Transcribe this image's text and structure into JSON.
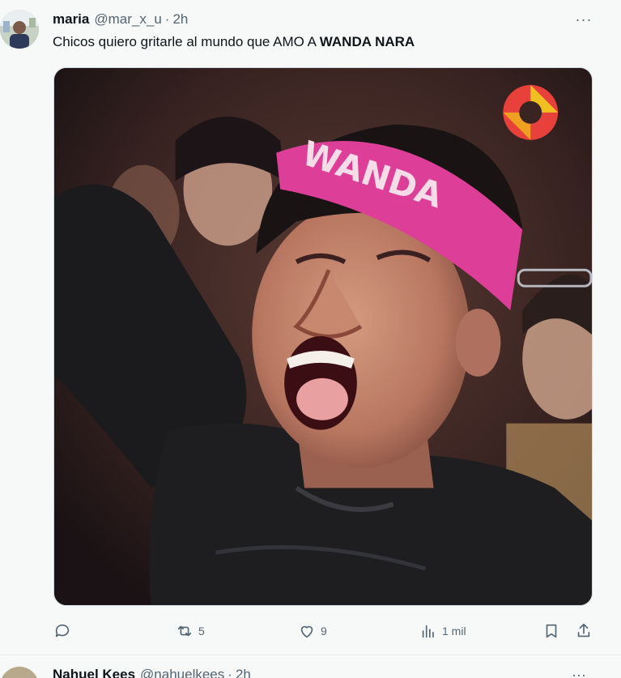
{
  "tweet": {
    "display_name": "maria",
    "handle": "@mar_x_u",
    "separator": "·",
    "time": "2h",
    "more_label": "···",
    "text_prefix": "Chicos quiero gritarle al mundo que AMO A ",
    "text_bold": "WANDA NARA",
    "media": {
      "headband_text": "WANDA",
      "description": "screaming man with pink headband"
    },
    "actions": {
      "reply_count": "",
      "retweet_count": "5",
      "like_count": "9",
      "views_count": "1 mil"
    }
  },
  "next_tweet": {
    "display_name": "Nahuel Kees",
    "handle": "@nahuelkees",
    "separator": "·",
    "time": "2h",
    "more_label": "···"
  },
  "colors": {
    "text_primary": "#0f1419",
    "text_secondary": "#536471",
    "background": "#f7f9f9",
    "headband": "#e0409a"
  }
}
